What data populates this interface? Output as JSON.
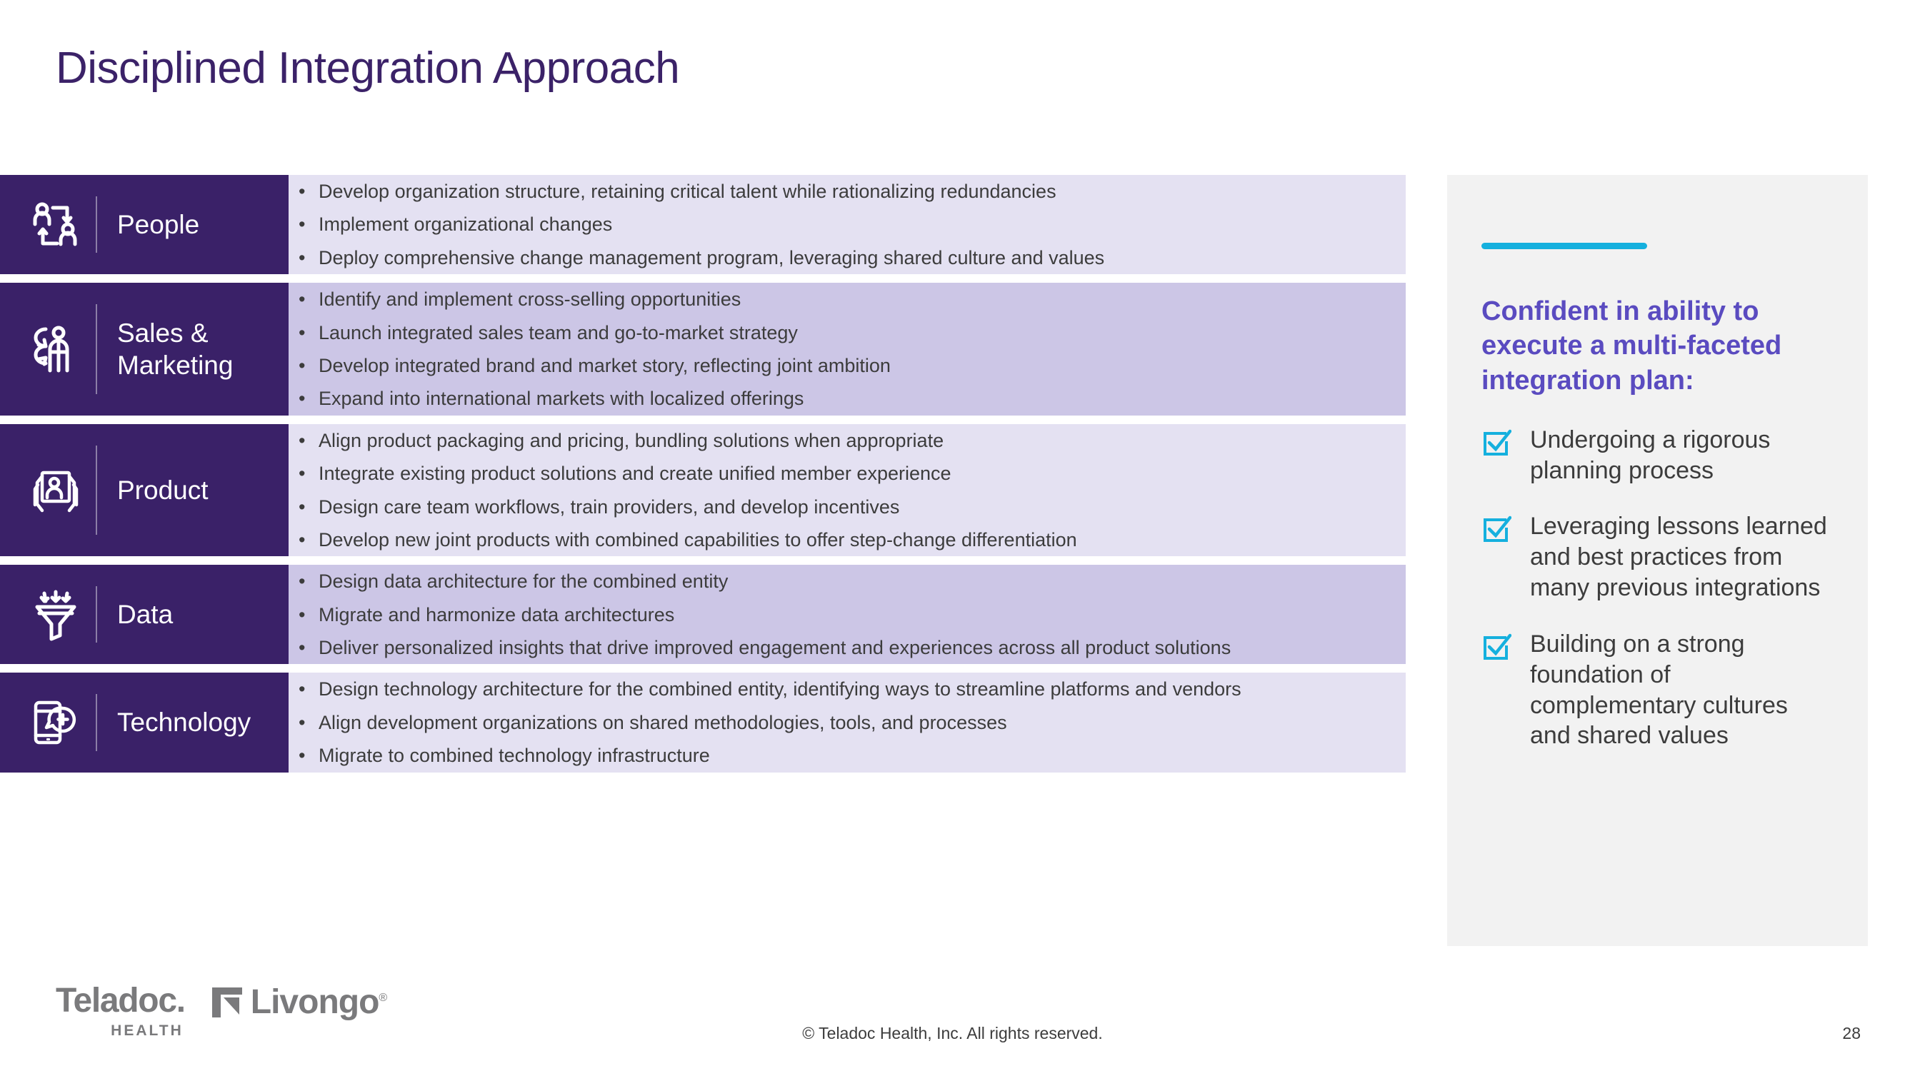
{
  "title": "Disciplined Integration Approach",
  "colors": {
    "title_purple": "#3B2268",
    "label_block_purple": "#3A2168",
    "row_tint_light": "#E4E1F2",
    "row_tint_dark": "#CCC6E6",
    "sidebar_bg": "#F2F2F2",
    "sidebar_heading_purple": "#5A4BC0",
    "accent_cyan": "#15B0DE",
    "body_text": "#3C3C3C",
    "logo_gray": "#7A7A7C"
  },
  "rows": [
    {
      "label": "People",
      "icon": "people-exchange-icon",
      "tint": "light",
      "bullets": [
        "Develop organization structure, retaining critical talent while rationalizing redundancies",
        "Implement organizational changes",
        "Deploy comprehensive change management program, leveraging shared culture and values"
      ]
    },
    {
      "label": "Sales &\nMarketing",
      "label_line1": "Sales &",
      "label_line2": "Marketing",
      "icon": "salesperson-dollar-icon",
      "tint": "dark",
      "bullets": [
        "Identify and implement cross-selling opportunities",
        "Launch integrated sales team and go-to-market strategy",
        "Develop integrated brand and market story, reflecting joint ambition",
        "Expand into international markets with localized offerings"
      ]
    },
    {
      "label": "Product",
      "icon": "hands-holding-screen-icon",
      "tint": "light",
      "bullets": [
        "Align product packaging and pricing, bundling solutions when appropriate",
        "Integrate existing product solutions and create unified member experience",
        "Design care team workflows, train providers, and develop incentives",
        "Develop new joint products with combined capabilities to offer step-change differentiation"
      ]
    },
    {
      "label": "Data",
      "icon": "funnel-icon",
      "tint": "dark",
      "bullets": [
        "Design data architecture for the combined entity",
        "Migrate and harmonize data architectures",
        "Deliver personalized insights that drive improved engagement and experiences across all product solutions"
      ]
    },
    {
      "label": "Technology",
      "icon": "phone-medical-chat-icon",
      "tint": "light",
      "bullets": [
        "Design technology architecture for the combined entity, identifying ways to streamline platforms and vendors",
        "Align development organizations on shared methodologies, tools, and processes",
        "Migrate to combined technology infrastructure"
      ]
    }
  ],
  "sidebar": {
    "heading": "Confident in ability to execute a multi-faceted integration plan:",
    "items": [
      {
        "icon": "checkbox-checked-icon",
        "text": "Undergoing a rigorous planning process"
      },
      {
        "icon": "checkbox-checked-icon",
        "text": "Leveraging lessons learned and best practices from many previous integrations"
      },
      {
        "icon": "checkbox-checked-icon",
        "text": "Building on a strong foundation of complementary cultures and shared values"
      }
    ]
  },
  "footer": {
    "teladoc_logo_main": "Teladoc.",
    "teladoc_logo_sub": "HEALTH",
    "livongo_logo_text": "Livongo",
    "livongo_logo_registered": "®",
    "copyright": "© Teladoc Health, Inc. All rights reserved.",
    "page_number": "28"
  },
  "bullet_glyph": "•"
}
